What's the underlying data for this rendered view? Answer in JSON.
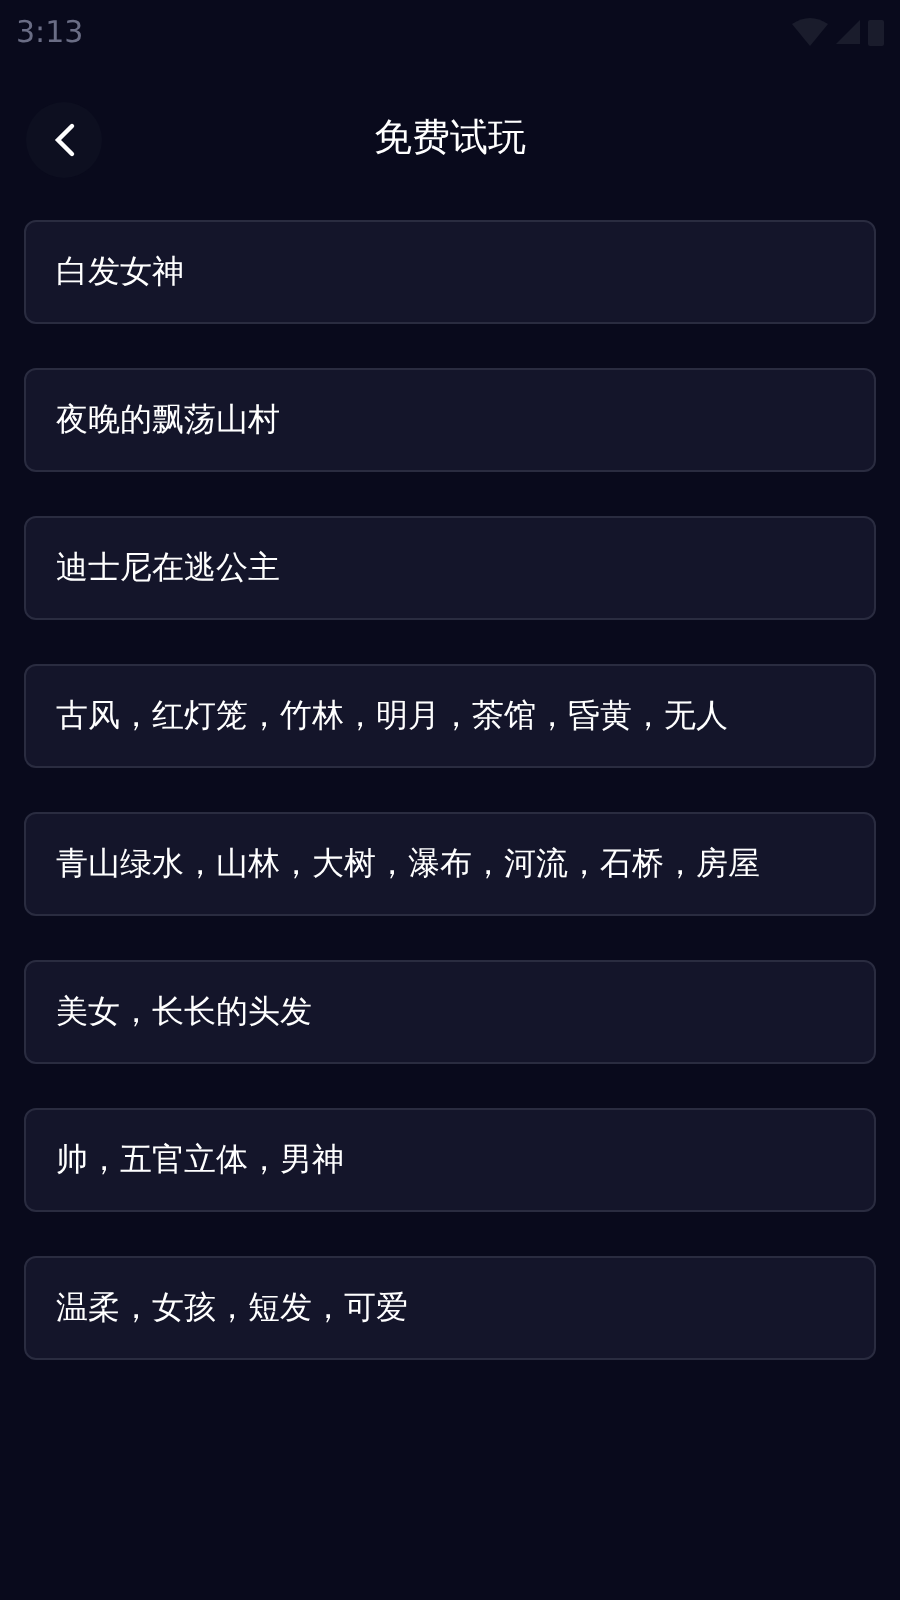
{
  "status_bar": {
    "time": "3:13"
  },
  "header": {
    "title": "免费试玩"
  },
  "prompts": [
    {
      "text": "白发女神"
    },
    {
      "text": "夜晚的飘荡山村"
    },
    {
      "text": "迪士尼在逃公主"
    },
    {
      "text": "古风，红灯笼，竹林，明月，茶馆，昏黄，无人"
    },
    {
      "text": "青山绿水，山林，大树，瀑布，河流，石桥，房屋"
    },
    {
      "text": "美女，长长的头发"
    },
    {
      "text": "帅，五官立体，男神"
    },
    {
      "text": "温柔，女孩，短发，可爱"
    }
  ]
}
